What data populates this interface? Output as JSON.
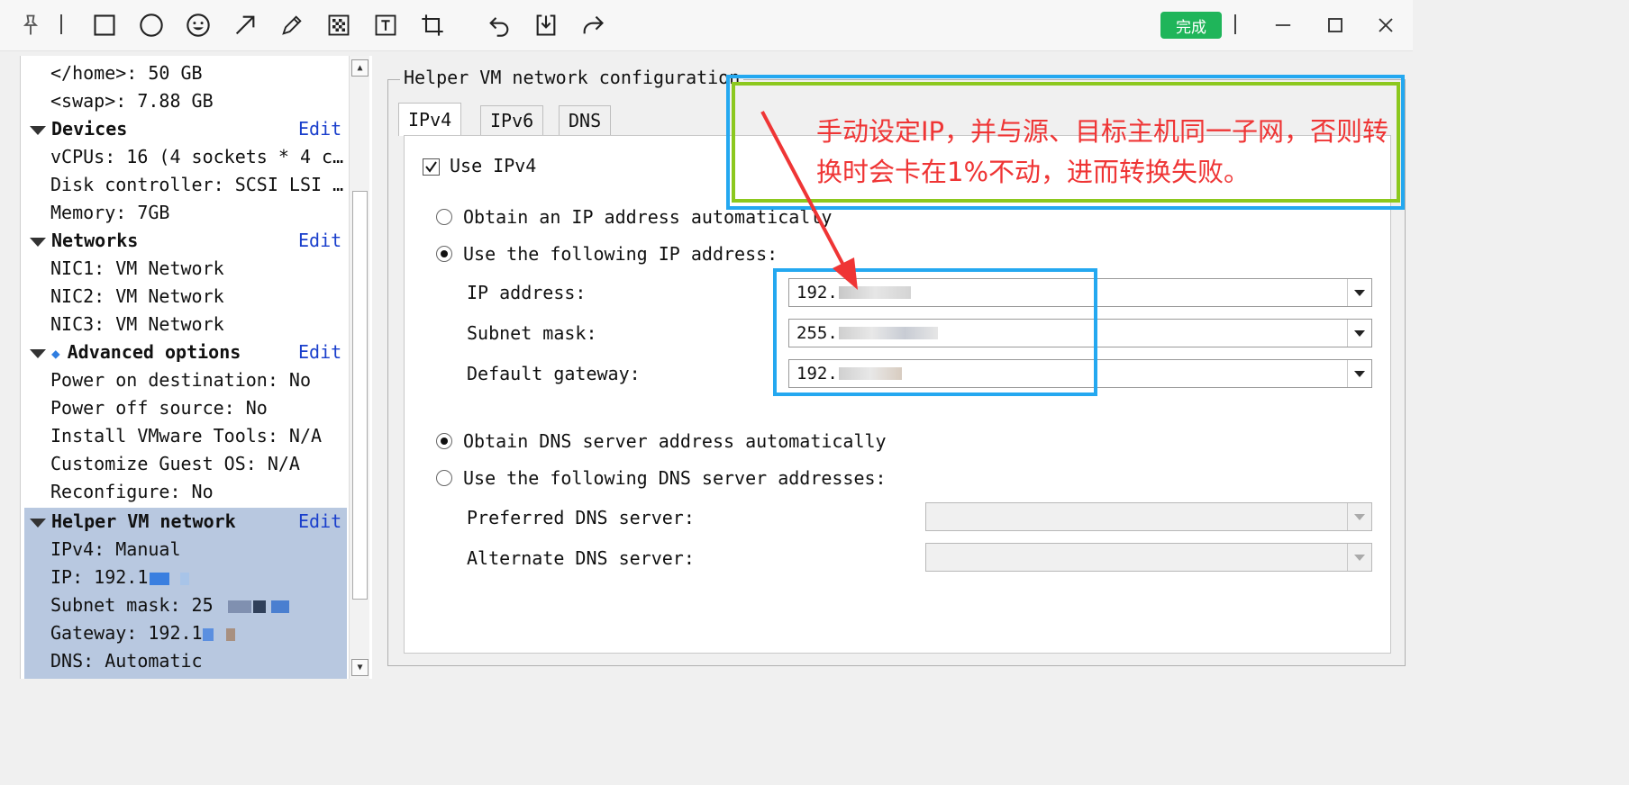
{
  "toolbar": {
    "tools": [
      "pin-icon",
      "rectangle-icon",
      "ellipse-icon",
      "emoji-icon",
      "arrow-icon",
      "pencil-icon",
      "mosaic-icon",
      "text-icon",
      "crop-icon",
      "undo-icon",
      "save-icon",
      "share-icon"
    ],
    "done_label": "完成"
  },
  "left": {
    "lines": [
      {
        "kind": "text",
        "text": "</home>: 50 GB"
      },
      {
        "kind": "text",
        "text": "<swap>: 7.88 GB"
      },
      {
        "kind": "head",
        "text": "Devices",
        "edit": "Edit"
      },
      {
        "kind": "text",
        "text": "vCPUs: 16 (4 sockets * 4 c…"
      },
      {
        "kind": "text",
        "text": "Disk controller: SCSI LSI …"
      },
      {
        "kind": "text",
        "text": "Memory: 7GB"
      },
      {
        "kind": "head",
        "text": "Networks",
        "edit": "Edit"
      },
      {
        "kind": "text",
        "text": "NIC1: VM Network"
      },
      {
        "kind": "text",
        "text": "NIC2: VM Network"
      },
      {
        "kind": "text",
        "text": "NIC3: VM Network"
      },
      {
        "kind": "head",
        "text": "Advanced options",
        "edit": "Edit"
      },
      {
        "kind": "text",
        "text": "Power on destination: No"
      },
      {
        "kind": "text",
        "text": "Power off source: No"
      },
      {
        "kind": "text",
        "text": "Install VMware Tools: N/A"
      },
      {
        "kind": "text",
        "text": "Customize Guest OS: N/A"
      },
      {
        "kind": "text",
        "text": "Reconfigure: No"
      },
      {
        "kind": "head",
        "text": "Helper VM network",
        "edit": "Edit"
      },
      {
        "kind": "text",
        "text": "IPv4: Manual"
      },
      {
        "kind": "text",
        "text": "IP: 192.1"
      },
      {
        "kind": "text",
        "text": "Subnet mask: 25"
      },
      {
        "kind": "text",
        "text": "Gateway: 192.1"
      },
      {
        "kind": "text",
        "text": "DNS: Automatic"
      }
    ]
  },
  "right": {
    "group_title": "Helper VM network configuration",
    "tabs": [
      "IPv4",
      "IPv6",
      "DNS"
    ],
    "use_ipv4": "Use IPv4",
    "radio_auto_ip": "Obtain an IP address automatically",
    "radio_manual_ip": "Use the following IP address:",
    "ip_label": "IP address:",
    "ip_value": "192.",
    "mask_label": "Subnet mask:",
    "mask_value": "255.",
    "gw_label": "Default gateway:",
    "gw_value": "192.",
    "radio_auto_dns": "Obtain DNS server address automatically",
    "radio_manual_dns": "Use the following DNS server addresses:",
    "pref_dns_label": "Preferred DNS server:",
    "alt_dns_label": "Alternate DNS server:"
  },
  "annotation": {
    "note": "手动设定IP，并与源、目标主机同一子网，否则转换时会卡在1%不动，进而转换失败。"
  },
  "colors": {
    "annotation_red": "#ef3535",
    "highlight_blue": "#24a8f0",
    "highlight_green": "#8cc81e",
    "done_green": "#1fb55a",
    "link_blue": "#1a3fcc"
  }
}
